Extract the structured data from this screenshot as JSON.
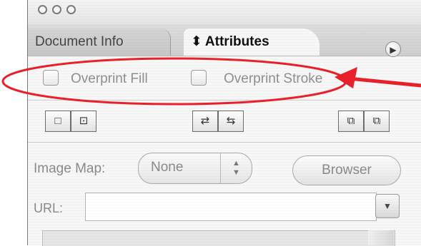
{
  "tabs": {
    "document_info": "Document Info",
    "attributes": "Attributes",
    "attributes_indicator": "⬍"
  },
  "overprint": {
    "fill_label": "Overprint Fill",
    "stroke_label": "Overprint Stroke"
  },
  "image_map": {
    "label": "Image Map:",
    "value": "None",
    "browser_button": "Browser"
  },
  "url": {
    "label": "URL:",
    "value": ""
  },
  "annotation": {
    "color": "#e8202a"
  }
}
